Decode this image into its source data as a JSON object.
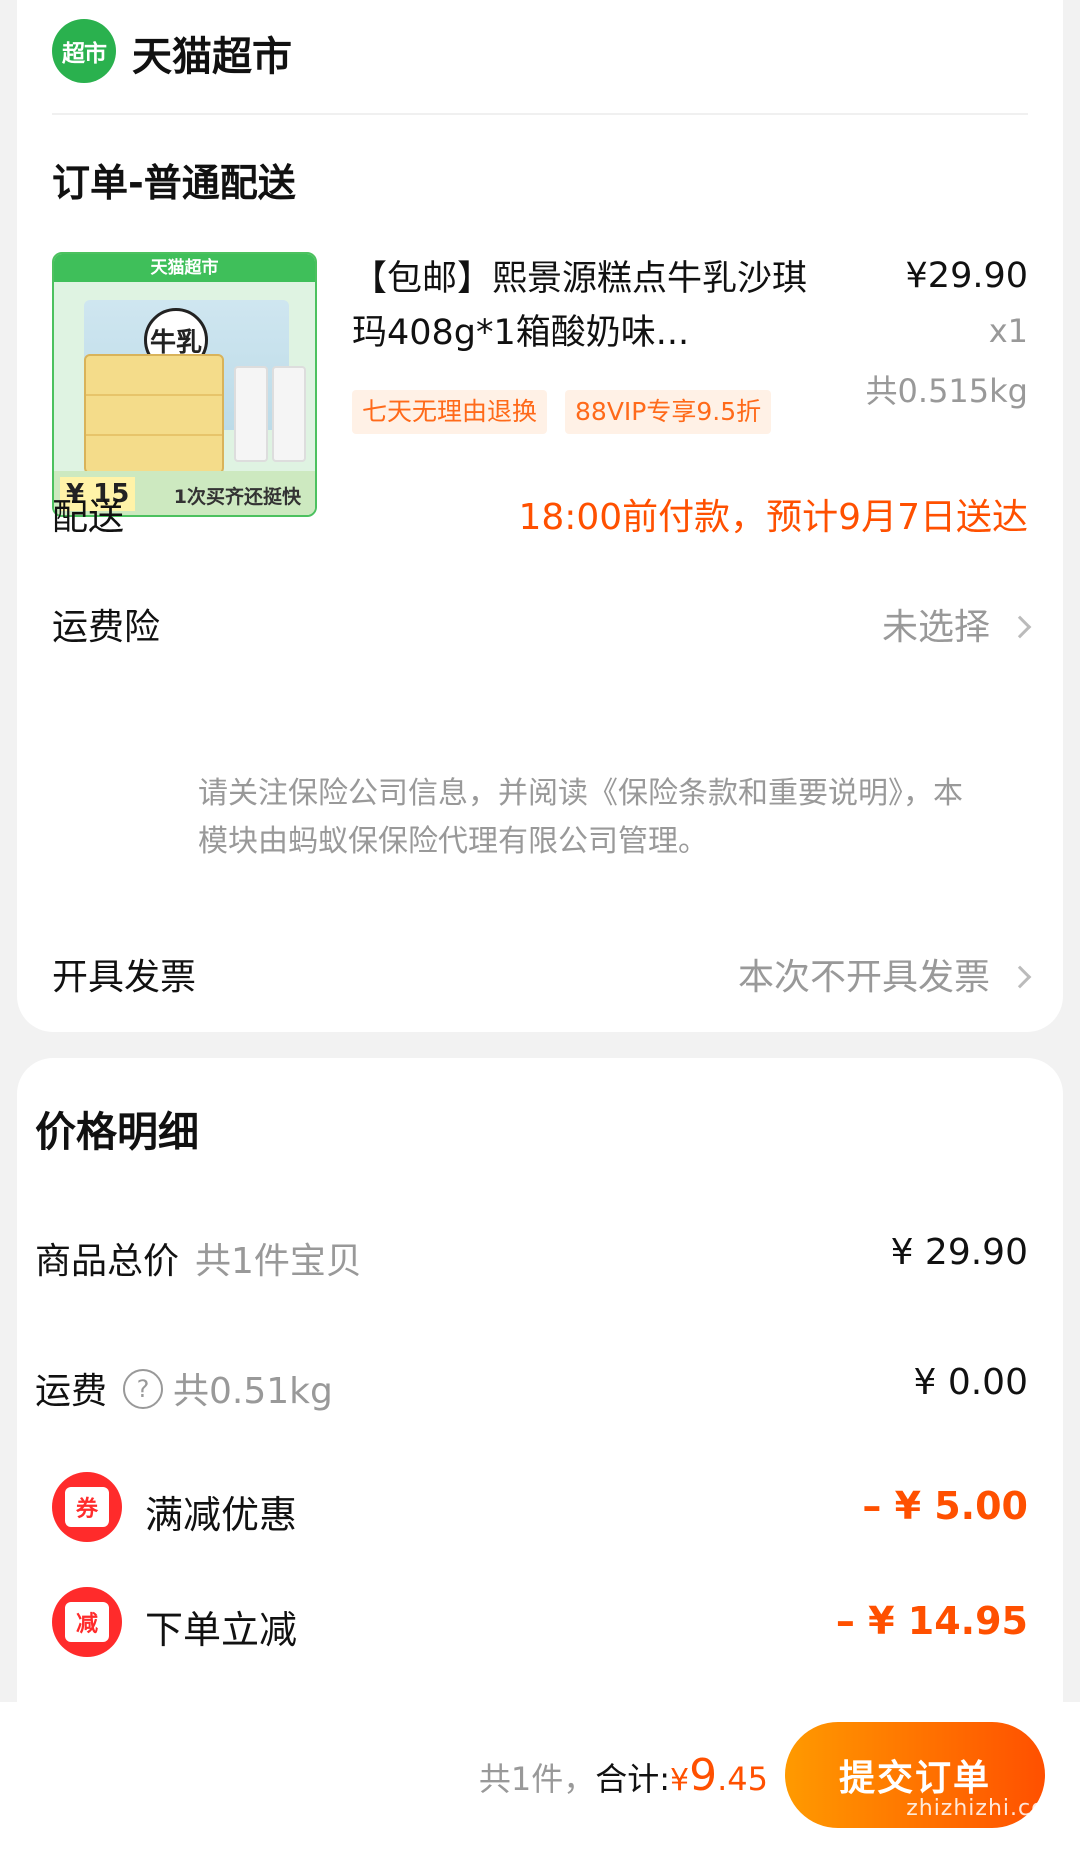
{
  "store": {
    "logo_text": "超市",
    "name": "天猫超市"
  },
  "order": {
    "title": "订单-普通配送"
  },
  "product": {
    "title": "【包邮】熙景源糕点牛乳沙琪玛408g*1箱酸奶味...",
    "price": "¥29.90",
    "qty": "x1",
    "weight": "共0.515kg",
    "tags": [
      "七天无理由退换",
      "88VIP专享9.5折"
    ],
    "image": {
      "banner": "天猫超市",
      "badge": "牛乳",
      "price": "¥ 15",
      "slogan": "1次买齐还挺快"
    }
  },
  "delivery": {
    "label": "配送",
    "value": "18:00前付款，预计9月7日送达"
  },
  "insurance": {
    "label": "运费险",
    "value": "未选择",
    "note": "请关注保险公司信息，并阅读《保险条款和重要说明》，本模块由蚂蚁保保险代理有限公司管理。"
  },
  "invoice": {
    "label": "开具发票",
    "value": "本次不开具发票"
  },
  "price_detail": {
    "title": "价格明细",
    "goods_label": "商品总价",
    "goods_count": "共1件宝贝",
    "goods_value": "¥ 29.90",
    "shipping_label": "运费",
    "shipping_weight": "共0.51kg",
    "shipping_value": "¥ 0.00",
    "discount1_icon": "券",
    "discount1_label": "满减优惠",
    "discount1_value": "– ¥ 5.00",
    "discount2_icon": "减",
    "discount2_label": "下单立减",
    "discount2_value": "– ¥ 14.95"
  },
  "footer": {
    "count": "共1件，",
    "total_label": "合计:",
    "currency": "¥",
    "total_int": "9",
    "total_dec": ".45",
    "submit": "提交订单",
    "watermark": "zhizhizhi.com"
  },
  "colors": {
    "accent": "#ff5000",
    "brand_green": "#2ab14e"
  }
}
